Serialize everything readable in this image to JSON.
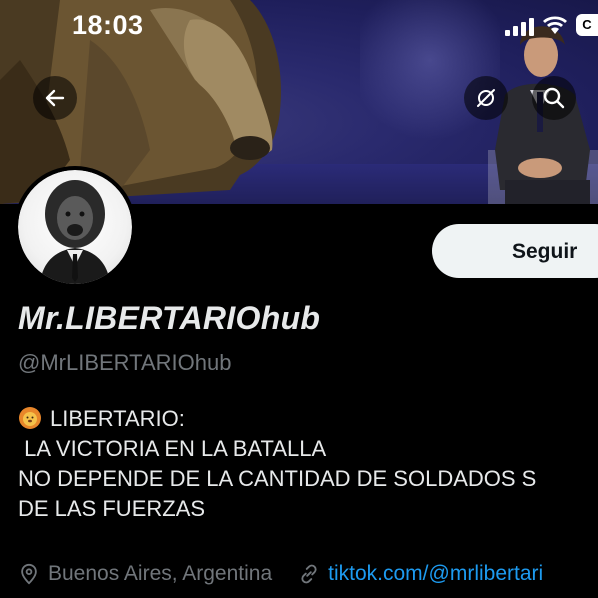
{
  "status_bar": {
    "time": "18:03",
    "battery": "C"
  },
  "header": {
    "back_icon": "arrow-left-icon",
    "grok_icon": "grok-icon",
    "search_icon": "search-icon"
  },
  "profile": {
    "follow_label": "Seguir",
    "display_name": "Mr.LIBERTARIOhub",
    "handle": "@MrLIBERTARIOhub",
    "bio_emoji": "lion-face",
    "bio_lines": [
      "LIBERTARIO:",
      " LA VICTORIA EN LA BATALLA",
      "NO DEPENDE DE LA CANTIDAD DE SOLDADOS S",
      "DE LAS FUERZAS"
    ],
    "location": "Buenos Aires, Argentina",
    "website": "tiktok.com/@mrlibertari"
  },
  "colors": {
    "link": "#1d9bf0",
    "muted": "#71767b",
    "text": "#e7e9ea",
    "button_bg": "#eff3f4"
  }
}
